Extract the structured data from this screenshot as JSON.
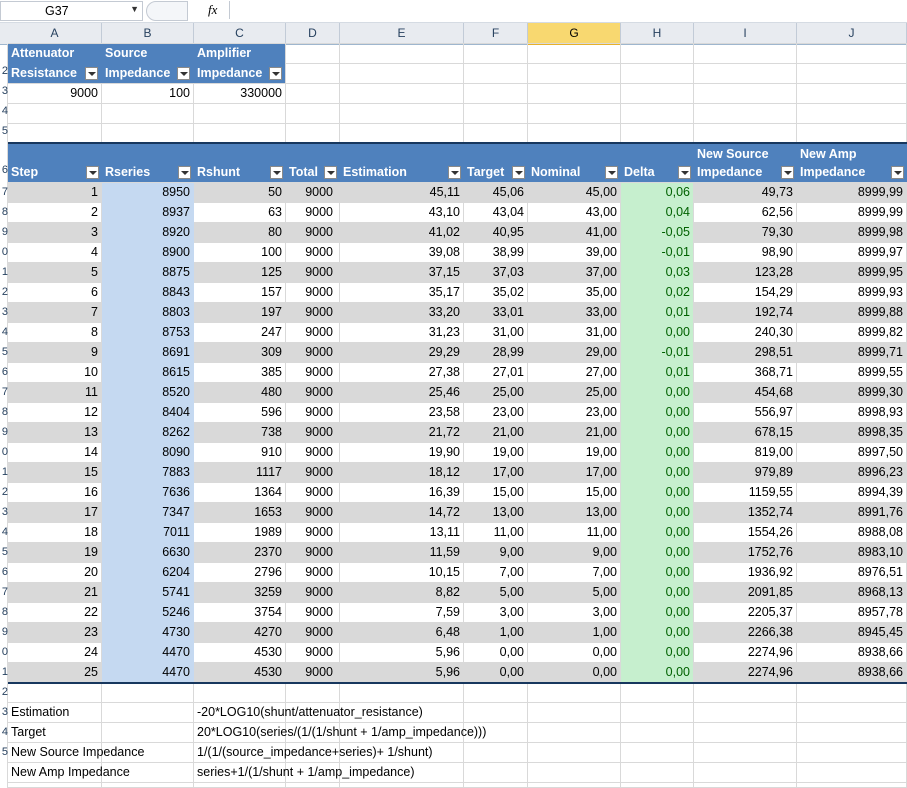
{
  "formula_bar": {
    "name_box": "G37",
    "fx": "fx"
  },
  "columns": [
    "A",
    "B",
    "C",
    "D",
    "E",
    "F",
    "G",
    "H",
    "I",
    "J"
  ],
  "selected_column": "G",
  "row_numbers": [
    "",
    "2",
    "3",
    "4",
    "5",
    "6",
    "7",
    "8",
    "9",
    "0",
    "1",
    "2",
    "3",
    "4",
    "5",
    "6",
    "7",
    "8",
    "9",
    "0",
    "1",
    "2",
    "3",
    "4",
    "5",
    "6",
    "7",
    "8",
    "9",
    "0",
    "1",
    "2",
    "3",
    "4",
    "5"
  ],
  "params": {
    "headers": [
      [
        "Attenuator",
        "Resistance"
      ],
      [
        "Source",
        "Impedance"
      ],
      [
        "Amplifier",
        "Impedance"
      ]
    ],
    "values": [
      "9000",
      "100",
      "330000"
    ]
  },
  "table": {
    "headers": [
      {
        "l1": "",
        "l2": "Step"
      },
      {
        "l1": "",
        "l2": "Rseries"
      },
      {
        "l1": "",
        "l2": "Rshunt"
      },
      {
        "l1": "",
        "l2": "Total"
      },
      {
        "l1": "",
        "l2": "Estimation"
      },
      {
        "l1": "",
        "l2": "Target"
      },
      {
        "l1": "",
        "l2": "Nominal"
      },
      {
        "l1": "",
        "l2": "Delta"
      },
      {
        "l1": "New Source",
        "l2": "Impedance"
      },
      {
        "l1": "New Amp",
        "l2": "Impedance"
      }
    ],
    "rows": [
      [
        "1",
        "8950",
        "50",
        "9000",
        "45,11",
        "45,06",
        "45,00",
        "0,06",
        "49,73",
        "8999,99"
      ],
      [
        "2",
        "8937",
        "63",
        "9000",
        "43,10",
        "43,04",
        "43,00",
        "0,04",
        "62,56",
        "8999,99"
      ],
      [
        "3",
        "8920",
        "80",
        "9000",
        "41,02",
        "40,95",
        "41,00",
        "-0,05",
        "79,30",
        "8999,98"
      ],
      [
        "4",
        "8900",
        "100",
        "9000",
        "39,08",
        "38,99",
        "39,00",
        "-0,01",
        "98,90",
        "8999,97"
      ],
      [
        "5",
        "8875",
        "125",
        "9000",
        "37,15",
        "37,03",
        "37,00",
        "0,03",
        "123,28",
        "8999,95"
      ],
      [
        "6",
        "8843",
        "157",
        "9000",
        "35,17",
        "35,02",
        "35,00",
        "0,02",
        "154,29",
        "8999,93"
      ],
      [
        "7",
        "8803",
        "197",
        "9000",
        "33,20",
        "33,01",
        "33,00",
        "0,01",
        "192,74",
        "8999,88"
      ],
      [
        "8",
        "8753",
        "247",
        "9000",
        "31,23",
        "31,00",
        "31,00",
        "0,00",
        "240,30",
        "8999,82"
      ],
      [
        "9",
        "8691",
        "309",
        "9000",
        "29,29",
        "28,99",
        "29,00",
        "-0,01",
        "298,51",
        "8999,71"
      ],
      [
        "10",
        "8615",
        "385",
        "9000",
        "27,38",
        "27,01",
        "27,00",
        "0,01",
        "368,71",
        "8999,55"
      ],
      [
        "11",
        "8520",
        "480",
        "9000",
        "25,46",
        "25,00",
        "25,00",
        "0,00",
        "454,68",
        "8999,30"
      ],
      [
        "12",
        "8404",
        "596",
        "9000",
        "23,58",
        "23,00",
        "23,00",
        "0,00",
        "556,97",
        "8998,93"
      ],
      [
        "13",
        "8262",
        "738",
        "9000",
        "21,72",
        "21,00",
        "21,00",
        "0,00",
        "678,15",
        "8998,35"
      ],
      [
        "14",
        "8090",
        "910",
        "9000",
        "19,90",
        "19,00",
        "19,00",
        "0,00",
        "819,00",
        "8997,50"
      ],
      [
        "15",
        "7883",
        "1117",
        "9000",
        "18,12",
        "17,00",
        "17,00",
        "0,00",
        "979,89",
        "8996,23"
      ],
      [
        "16",
        "7636",
        "1364",
        "9000",
        "16,39",
        "15,00",
        "15,00",
        "0,00",
        "1159,55",
        "8994,39"
      ],
      [
        "17",
        "7347",
        "1653",
        "9000",
        "14,72",
        "13,00",
        "13,00",
        "0,00",
        "1352,74",
        "8991,76"
      ],
      [
        "18",
        "7011",
        "1989",
        "9000",
        "13,11",
        "11,00",
        "11,00",
        "0,00",
        "1554,26",
        "8988,08"
      ],
      [
        "19",
        "6630",
        "2370",
        "9000",
        "11,59",
        "9,00",
        "9,00",
        "0,00",
        "1752,76",
        "8983,10"
      ],
      [
        "20",
        "6204",
        "2796",
        "9000",
        "10,15",
        "7,00",
        "7,00",
        "0,00",
        "1936,92",
        "8976,51"
      ],
      [
        "21",
        "5741",
        "3259",
        "9000",
        "8,82",
        "5,00",
        "5,00",
        "0,00",
        "2091,85",
        "8968,13"
      ],
      [
        "22",
        "5246",
        "3754",
        "9000",
        "7,59",
        "3,00",
        "3,00",
        "0,00",
        "2205,37",
        "8957,78"
      ],
      [
        "23",
        "4730",
        "4270",
        "9000",
        "6,48",
        "1,00",
        "1,00",
        "0,00",
        "2266,38",
        "8945,45"
      ],
      [
        "24",
        "4470",
        "4530",
        "9000",
        "5,96",
        "0,00",
        "0,00",
        "0,00",
        "2274,96",
        "8938,66"
      ],
      [
        "25",
        "4470",
        "4530",
        "9000",
        "5,96",
        "0,00",
        "0,00",
        "0,00",
        "2274,96",
        "8938,66"
      ]
    ]
  },
  "formulas": [
    {
      "label": "Estimation",
      "formula": "-20*LOG10(shunt/attenuator_resistance)"
    },
    {
      "label": "Target",
      "formula": "20*LOG10(series/(1/(1/shunt + 1/amp_impedance)))"
    },
    {
      "label": "New Source Impedance",
      "formula": "1/(1/(source_impedance+series)+ 1/shunt)"
    },
    {
      "label": "New Amp Impedance",
      "formula": "series+1/(1/shunt + 1/amp_impedance)"
    }
  ],
  "colors": {
    "header_blue": "#4f81bd",
    "header_navy": "#17375e",
    "band_gray": "#d9d9d9",
    "col_b_blue": "#c5d9f1",
    "col_h_green": "#c6efce",
    "selected_col": "#f8d870"
  }
}
